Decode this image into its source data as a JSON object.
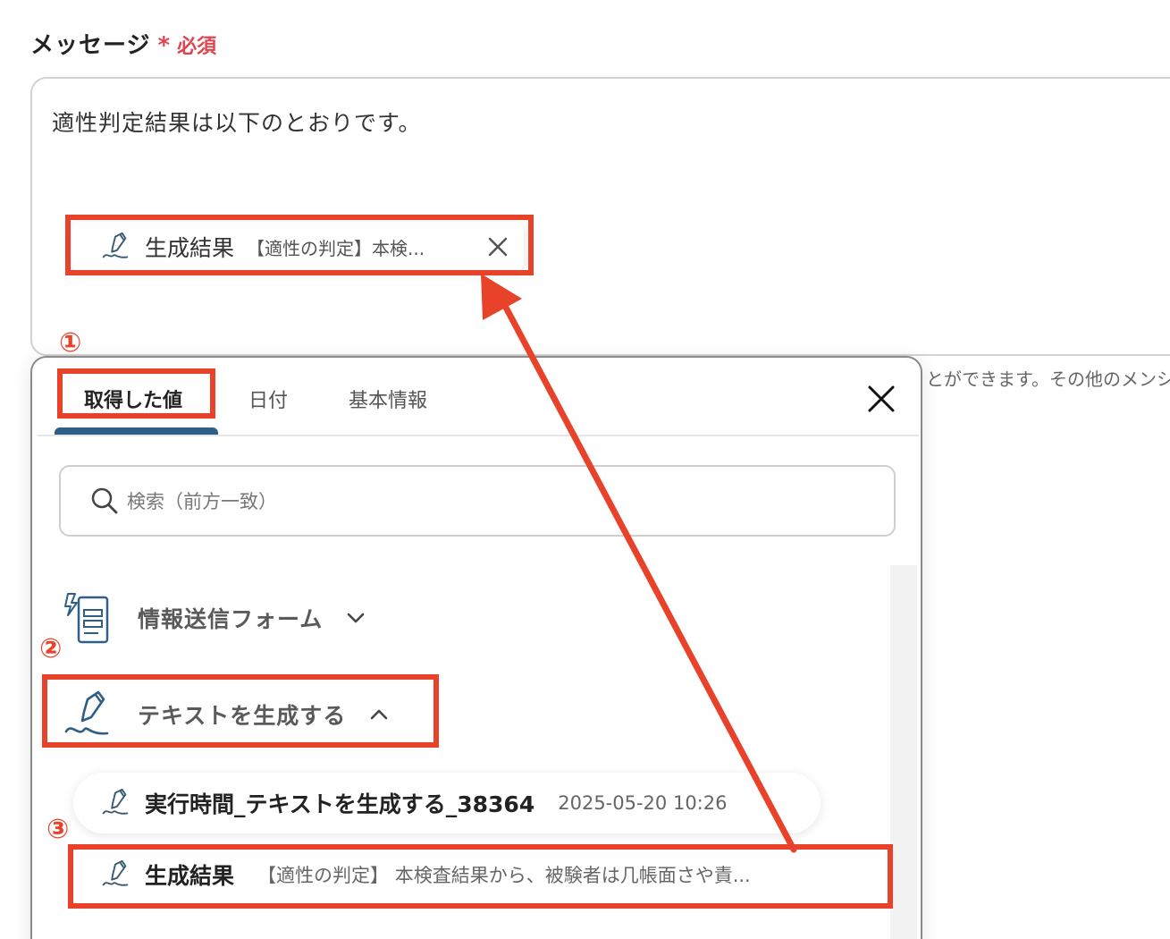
{
  "field": {
    "label": "メッセージ",
    "required_star": "*",
    "required_text": "必須"
  },
  "message": {
    "text": "適性判定結果は以下のとおりです。",
    "chip": {
      "title": "生成結果",
      "preview": "【適性の判定】本検..."
    }
  },
  "helper_text": "とができます。その他のメンシ",
  "popup": {
    "tabs": [
      {
        "label": "取得した値"
      },
      {
        "label": "日付"
      },
      {
        "label": "基本情報"
      }
    ],
    "search_placeholder": "検索（前方一致）",
    "groups": [
      {
        "label": "情報送信フォーム",
        "icon": "form-icon",
        "state": "collapsed"
      },
      {
        "label": "テキストを生成する",
        "icon": "pen-icon",
        "state": "expanded"
      }
    ],
    "items": [
      {
        "title": "実行時間_テキストを生成する_38364",
        "value": "2025-05-20 10:26"
      },
      {
        "title": "生成結果",
        "value": "【適性の判定】 本検査結果から、被験者は几帳面さや責..."
      }
    ]
  },
  "annotations": {
    "step1": "①",
    "step2": "②",
    "step3": "③",
    "color": "#e8432a"
  }
}
